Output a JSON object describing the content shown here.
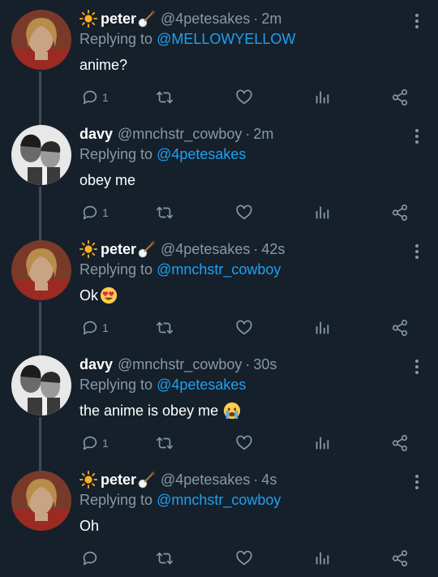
{
  "tweets": [
    {
      "name": "peter",
      "handle": "@4petesakes",
      "dot": "·",
      "time": "2m",
      "replying_prefix": "Replying to",
      "replying_to": "@MELLOWYELLOW",
      "text": "anime?",
      "reply_count": "1",
      "avatar": "peter",
      "prefix_icon": "sun-icon",
      "name_icon": "banjo-icon"
    },
    {
      "name": "davy",
      "handle": "@mnchstr_cowboy",
      "dot": "·",
      "time": "2m",
      "replying_prefix": "Replying to",
      "replying_to": "@4petesakes",
      "text": "obey me",
      "reply_count": "1",
      "avatar": "davy"
    },
    {
      "name": "peter",
      "handle": "@4petesakes",
      "dot": "·",
      "time": "42s",
      "replying_prefix": "Replying to",
      "replying_to": "@mnchstr_cowboy",
      "text": "Ok",
      "reply_count": "1",
      "avatar": "peter",
      "text_emoji": "heart-eyes-emoji"
    },
    {
      "name": "davy",
      "handle": "@mnchstr_cowboy",
      "dot": "·",
      "time": "30s",
      "replying_prefix": "Replying to",
      "replying_to": "@4petesakes",
      "text": "the anime is obey me",
      "reply_count": "1",
      "avatar": "davy",
      "text_emoji": "crying-emoji"
    },
    {
      "name": "peter",
      "handle": "@4petesakes",
      "dot": "·",
      "time": "4s",
      "replying_prefix": "Replying to",
      "replying_to": "@mnchstr_cowboy",
      "text": "Oh",
      "reply_count": "",
      "avatar": "peter"
    }
  ],
  "colors": {
    "background": "#15202b",
    "secondary_text": "#8899a6",
    "mention": "#1da1f2",
    "thread_line": "#3d4b59",
    "sun": "#ffad1f"
  }
}
